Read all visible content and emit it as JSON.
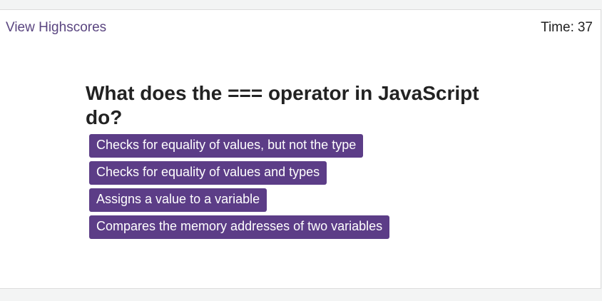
{
  "header": {
    "highscores_label": "View Highscores",
    "timer_label": "Time:",
    "timer_value": "37"
  },
  "quiz": {
    "question": "What does the === operator in JavaScript do?",
    "choices": [
      {
        "label": "Checks for equality of values, but not the type"
      },
      {
        "label": "Checks for equality of values and types"
      },
      {
        "label": "Assigns a value to a variable"
      },
      {
        "label": "Compares the memory addresses of two variables"
      }
    ]
  },
  "colors": {
    "accent": "#5c3d87",
    "link": "#5a4580",
    "background": "#f3f4f4",
    "card": "#ffffff"
  }
}
